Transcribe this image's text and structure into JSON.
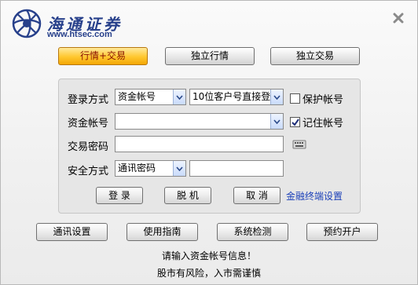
{
  "branding": {
    "name": "海通证券",
    "url": "www.htsec.com",
    "logo_color": "#27408b"
  },
  "window": {
    "close_icon": "close-icon"
  },
  "modes": [
    {
      "label": "行情+交易",
      "active": true
    },
    {
      "label": "独立行情",
      "active": false
    },
    {
      "label": "独立交易",
      "active": false
    }
  ],
  "login": {
    "method_label": "登录方式",
    "account_type": "资金帐号",
    "account_hint": "10位客户号直接登",
    "protect_account_label": "保护帐号",
    "protect_account_checked": false,
    "account_label": "资金帐号",
    "account_value": "",
    "remember_account_label": "记住帐号",
    "remember_account_checked": true,
    "password_label": "交易密码",
    "password_value": "",
    "security_label": "安全方式",
    "security_type": "通讯密码",
    "security_value": ""
  },
  "actions": {
    "login": "登 录",
    "offline": "脱 机",
    "cancel": "取 消",
    "terminal_settings": "金融终端设置"
  },
  "bottom": [
    {
      "label": "通讯设置"
    },
    {
      "label": "使用指南"
    },
    {
      "label": "系统检测"
    },
    {
      "label": "预约开户"
    }
  ],
  "status": {
    "prompt": "请输入资金帐号信息！",
    "warning": "股市有风险，入市需谨慎"
  },
  "colors": {
    "active_mode": "#ffc72e",
    "link": "#1a3fb8",
    "panel": "#e6e6e6"
  }
}
